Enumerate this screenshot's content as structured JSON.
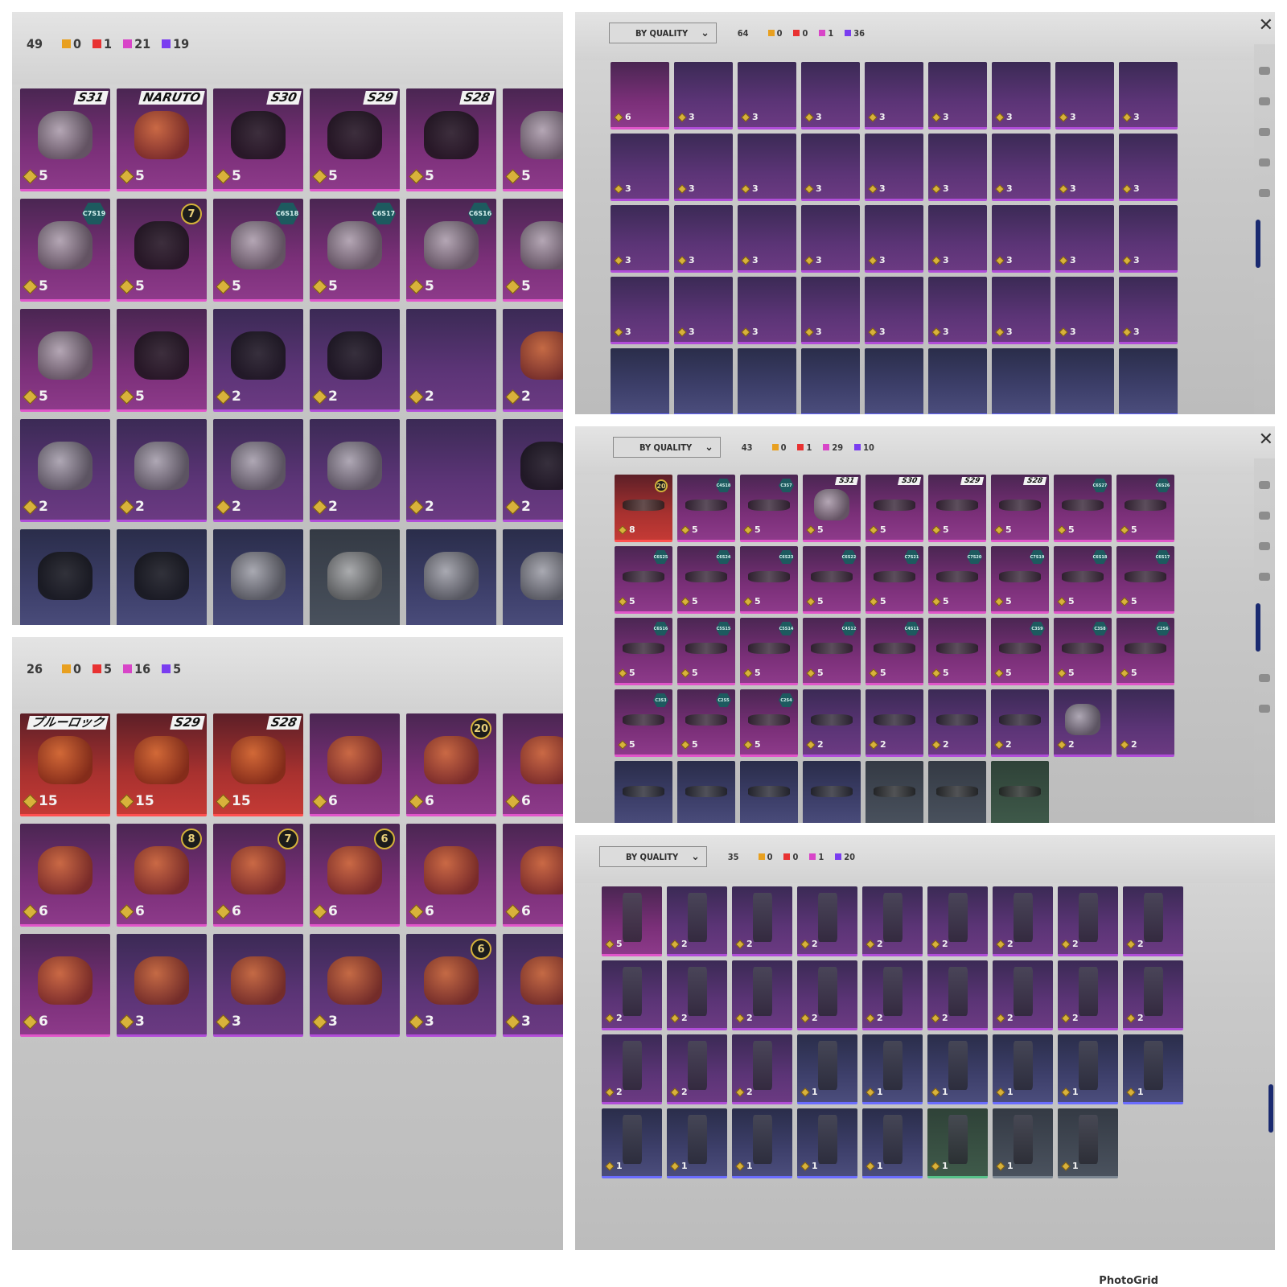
{
  "colors": {
    "orange": "#e8a020",
    "red": "#e83232",
    "pink": "#d845c8",
    "purple": "#7a3df0"
  },
  "panels": {
    "masks": {
      "header": {
        "total": "49",
        "counts": [
          "0",
          "1",
          "21",
          "19"
        ]
      },
      "cols": 6,
      "cards": [
        {
          "r": "pink",
          "t": "gear",
          "b": "S31",
          "v": "5"
        },
        {
          "r": "pink",
          "t": "helm",
          "b": "NARUTO",
          "v": "5"
        },
        {
          "r": "pink",
          "t": "mask",
          "b": "S30",
          "v": "5"
        },
        {
          "r": "pink",
          "t": "mask",
          "b": "S29",
          "v": "5"
        },
        {
          "r": "pink",
          "t": "mask",
          "b": "S28",
          "v": "5"
        },
        {
          "r": "pink",
          "t": "gear",
          "v": "5"
        },
        {
          "r": "pink",
          "t": "gear",
          "h": "C7S19",
          "v": "5"
        },
        {
          "r": "pink",
          "t": "mask",
          "g": "7",
          "v": "5"
        },
        {
          "r": "pink",
          "t": "gear",
          "h": "C6S18",
          "v": "5"
        },
        {
          "r": "pink",
          "t": "gear",
          "h": "C6S17",
          "v": "5"
        },
        {
          "r": "pink",
          "t": "gear",
          "h": "C6S16",
          "v": "5"
        },
        {
          "r": "pink",
          "t": "gear",
          "v": "5"
        },
        {
          "r": "pink",
          "t": "gear",
          "v": "5"
        },
        {
          "r": "pink",
          "t": "mask",
          "v": "5"
        },
        {
          "r": "purple",
          "t": "mask",
          "v": "2"
        },
        {
          "r": "purple",
          "t": "mask",
          "v": "2"
        },
        {
          "r": "purple",
          "t": "top",
          "v": "2"
        },
        {
          "r": "purple",
          "t": "helm",
          "v": "2"
        },
        {
          "r": "purple",
          "t": "gear",
          "v": "2"
        },
        {
          "r": "purple",
          "t": "gear",
          "v": "2"
        },
        {
          "r": "purple",
          "t": "gear",
          "v": "2"
        },
        {
          "r": "purple",
          "t": "gear",
          "v": "2"
        },
        {
          "r": "purple",
          "t": "top",
          "v": "2"
        },
        {
          "r": "purple",
          "t": "mask",
          "v": "2"
        },
        {
          "r": "blue",
          "t": "mask"
        },
        {
          "r": "blue",
          "t": "mask"
        },
        {
          "r": "blue",
          "t": "gear"
        },
        {
          "r": "gray",
          "t": "gear"
        },
        {
          "r": "blue",
          "t": "gear"
        },
        {
          "r": "blue",
          "t": "gear"
        }
      ]
    },
    "helmets": {
      "header": {
        "total": "26",
        "counts": [
          "0",
          "5",
          "16",
          "5"
        ]
      },
      "cols": 6,
      "cards": [
        {
          "r": "red",
          "t": "helm",
          "b": "ブルーロック",
          "v": "15"
        },
        {
          "r": "red",
          "t": "helm",
          "b": "S29",
          "v": "15"
        },
        {
          "r": "red",
          "t": "helm",
          "b": "S28",
          "v": "15"
        },
        {
          "r": "pink",
          "t": "helm",
          "v": "6"
        },
        {
          "r": "pink",
          "t": "helm",
          "g": "20",
          "v": "6"
        },
        {
          "r": "pink",
          "t": "helm",
          "v": "6"
        },
        {
          "r": "pink",
          "t": "helm",
          "v": "6"
        },
        {
          "r": "pink",
          "t": "helm",
          "g": "8",
          "v": "6"
        },
        {
          "r": "pink",
          "t": "helm",
          "g": "7",
          "v": "6"
        },
        {
          "r": "pink",
          "t": "helm",
          "g": "6",
          "v": "6"
        },
        {
          "r": "pink",
          "t": "helm",
          "v": "6"
        },
        {
          "r": "pink",
          "t": "helm",
          "v": "6"
        },
        {
          "r": "pink",
          "t": "helm",
          "v": "6"
        },
        {
          "r": "purple",
          "t": "helm",
          "v": "3"
        },
        {
          "r": "purple",
          "t": "helm",
          "v": "3"
        },
        {
          "r": "purple",
          "t": "helm",
          "v": "3"
        },
        {
          "r": "purple",
          "t": "helm",
          "g": "6",
          "v": "3"
        },
        {
          "r": "purple",
          "t": "helm",
          "v": "3"
        }
      ]
    },
    "tops": {
      "header": {
        "sort": "BY QUALITY",
        "total": "64",
        "counts": [
          "0",
          "0",
          "1",
          "36"
        ]
      },
      "cols": 9,
      "cards": [
        {
          "r": "pink",
          "t": "top",
          "v": "6"
        },
        {
          "r": "purple",
          "t": "top",
          "v": "3"
        },
        {
          "r": "purple",
          "t": "top",
          "v": "3"
        },
        {
          "r": "purple",
          "t": "top",
          "v": "3"
        },
        {
          "r": "purple",
          "t": "top",
          "v": "3"
        },
        {
          "r": "purple",
          "t": "top",
          "v": "3"
        },
        {
          "r": "purple",
          "t": "top",
          "v": "3"
        },
        {
          "r": "purple",
          "t": "top",
          "v": "3"
        },
        {
          "r": "purple",
          "t": "top",
          "v": "3"
        },
        {
          "r": "purple",
          "t": "top",
          "v": "3"
        },
        {
          "r": "purple",
          "t": "top",
          "v": "3"
        },
        {
          "r": "purple",
          "t": "top",
          "v": "3"
        },
        {
          "r": "purple",
          "t": "top",
          "v": "3"
        },
        {
          "r": "purple",
          "t": "top",
          "v": "3"
        },
        {
          "r": "purple",
          "t": "top",
          "v": "3"
        },
        {
          "r": "purple",
          "t": "top",
          "v": "3"
        },
        {
          "r": "purple",
          "t": "top",
          "v": "3"
        },
        {
          "r": "purple",
          "t": "top",
          "v": "3"
        },
        {
          "r": "purple",
          "t": "top",
          "v": "3"
        },
        {
          "r": "purple",
          "t": "top",
          "v": "3"
        },
        {
          "r": "purple",
          "t": "top",
          "v": "3"
        },
        {
          "r": "purple",
          "t": "top",
          "v": "3"
        },
        {
          "r": "purple",
          "t": "top",
          "v": "3"
        },
        {
          "r": "purple",
          "t": "top",
          "v": "3"
        },
        {
          "r": "purple",
          "t": "top",
          "v": "3"
        },
        {
          "r": "purple",
          "t": "top",
          "v": "3"
        },
        {
          "r": "purple",
          "t": "top",
          "v": "3"
        },
        {
          "r": "purple",
          "t": "top",
          "v": "3"
        },
        {
          "r": "purple",
          "t": "top",
          "v": "3"
        },
        {
          "r": "purple",
          "t": "top",
          "v": "3"
        },
        {
          "r": "purple",
          "t": "top",
          "v": "3"
        },
        {
          "r": "purple",
          "t": "top",
          "v": "3"
        },
        {
          "r": "purple",
          "t": "top",
          "v": "3"
        },
        {
          "r": "purple",
          "t": "top",
          "v": "3"
        },
        {
          "r": "purple",
          "t": "top",
          "v": "3"
        },
        {
          "r": "purple",
          "t": "top",
          "v": "3"
        },
        {
          "r": "blue",
          "t": "top"
        },
        {
          "r": "blue",
          "t": "top"
        },
        {
          "r": "blue",
          "t": "top"
        },
        {
          "r": "blue",
          "t": "top"
        },
        {
          "r": "blue",
          "t": "top"
        },
        {
          "r": "blue",
          "t": "top"
        },
        {
          "r": "blue",
          "t": "top"
        },
        {
          "r": "blue",
          "t": "top"
        },
        {
          "r": "blue",
          "t": "top"
        }
      ]
    },
    "glasses": {
      "header": {
        "sort": "BY QUALITY",
        "total": "43",
        "counts": [
          "0",
          "1",
          "29",
          "10"
        ]
      },
      "cols": 9,
      "cards": [
        {
          "r": "red",
          "t": "glass",
          "g": "20",
          "v": "8"
        },
        {
          "r": "pink",
          "t": "glass",
          "h": "C4S18",
          "v": "5"
        },
        {
          "r": "pink",
          "t": "glass",
          "h": "C3S7",
          "v": "5"
        },
        {
          "r": "pink",
          "t": "gear",
          "b": "S31",
          "v": "5"
        },
        {
          "r": "pink",
          "t": "glass",
          "b": "S30",
          "v": "5"
        },
        {
          "r": "pink",
          "t": "glass",
          "b": "S29",
          "v": "5"
        },
        {
          "r": "pink",
          "t": "glass",
          "b": "S28",
          "v": "5"
        },
        {
          "r": "pink",
          "t": "glass",
          "h": "C6S27",
          "v": "5"
        },
        {
          "r": "pink",
          "t": "glass",
          "h": "C6S26",
          "v": "5"
        },
        {
          "r": "pink",
          "t": "glass",
          "h": "C6S25",
          "v": "5"
        },
        {
          "r": "pink",
          "t": "glass",
          "h": "C6S24",
          "v": "5"
        },
        {
          "r": "pink",
          "t": "glass",
          "h": "C6S23",
          "v": "5"
        },
        {
          "r": "pink",
          "t": "glass",
          "h": "C6S22",
          "v": "5"
        },
        {
          "r": "pink",
          "t": "glass",
          "h": "C7S21",
          "v": "5"
        },
        {
          "r": "pink",
          "t": "glass",
          "h": "C7S20",
          "v": "5"
        },
        {
          "r": "pink",
          "t": "glass",
          "h": "C7S19",
          "v": "5"
        },
        {
          "r": "pink",
          "t": "glass",
          "h": "C6S18",
          "v": "5"
        },
        {
          "r": "pink",
          "t": "glass",
          "h": "C6S17",
          "v": "5"
        },
        {
          "r": "pink",
          "t": "glass",
          "h": "C6S16",
          "v": "5"
        },
        {
          "r": "pink",
          "t": "glass",
          "h": "C5S15",
          "v": "5"
        },
        {
          "r": "pink",
          "t": "glass",
          "h": "C5S14",
          "v": "5"
        },
        {
          "r": "pink",
          "t": "glass",
          "h": "C4S12",
          "v": "5"
        },
        {
          "r": "pink",
          "t": "glass",
          "h": "C4S11",
          "v": "5"
        },
        {
          "r": "pink",
          "t": "glass",
          "v": "5"
        },
        {
          "r": "pink",
          "t": "glass",
          "h": "C3S9",
          "v": "5"
        },
        {
          "r": "pink",
          "t": "glass",
          "h": "C3S8",
          "v": "5"
        },
        {
          "r": "pink",
          "t": "glass",
          "h": "C2S6",
          "v": "5"
        },
        {
          "r": "pink",
          "t": "glass",
          "h": "C3S3",
          "v": "5"
        },
        {
          "r": "pink",
          "t": "glass",
          "h": "C2S5",
          "v": "5"
        },
        {
          "r": "pink",
          "t": "glass",
          "h": "C2S4",
          "v": "5"
        },
        {
          "r": "purple",
          "t": "glass",
          "v": "2"
        },
        {
          "r": "purple",
          "t": "glass",
          "v": "2"
        },
        {
          "r": "purple",
          "t": "glass",
          "v": "2"
        },
        {
          "r": "purple",
          "t": "glass",
          "v": "2"
        },
        {
          "r": "purple",
          "t": "gear",
          "v": "2"
        },
        {
          "r": "purple",
          "t": "top",
          "v": "2"
        },
        {
          "r": "blue",
          "t": "glass"
        },
        {
          "r": "blue",
          "t": "glass"
        },
        {
          "r": "blue",
          "t": "glass"
        },
        {
          "r": "blue",
          "t": "glass"
        },
        {
          "r": "gray",
          "t": "glass"
        },
        {
          "r": "gray",
          "t": "glass"
        },
        {
          "r": "green",
          "t": "glass"
        }
      ]
    },
    "pants": {
      "header": {
        "sort": "BY QUALITY",
        "total": "35",
        "counts": [
          "0",
          "0",
          "1",
          "20"
        ]
      },
      "cols": 9,
      "cards": [
        {
          "r": "pink",
          "t": "pant",
          "v": "5"
        },
        {
          "r": "purple",
          "t": "pant",
          "v": "2"
        },
        {
          "r": "purple",
          "t": "pant",
          "v": "2"
        },
        {
          "r": "purple",
          "t": "pant",
          "v": "2"
        },
        {
          "r": "purple",
          "t": "pant",
          "v": "2"
        },
        {
          "r": "purple",
          "t": "pant",
          "v": "2"
        },
        {
          "r": "purple",
          "t": "pant",
          "v": "2"
        },
        {
          "r": "purple",
          "t": "pant",
          "v": "2"
        },
        {
          "r": "purple",
          "t": "pant",
          "v": "2"
        },
        {
          "r": "purple",
          "t": "pant",
          "v": "2"
        },
        {
          "r": "purple",
          "t": "pant",
          "v": "2"
        },
        {
          "r": "purple",
          "t": "pant",
          "v": "2"
        },
        {
          "r": "purple",
          "t": "pant",
          "v": "2"
        },
        {
          "r": "purple",
          "t": "pant",
          "v": "2"
        },
        {
          "r": "purple",
          "t": "pant",
          "v": "2"
        },
        {
          "r": "purple",
          "t": "pant",
          "v": "2"
        },
        {
          "r": "purple",
          "t": "pant",
          "v": "2"
        },
        {
          "r": "purple",
          "t": "pant",
          "v": "2"
        },
        {
          "r": "purple",
          "t": "pant",
          "v": "2"
        },
        {
          "r": "purple",
          "t": "pant",
          "v": "2"
        },
        {
          "r": "purple",
          "t": "pant",
          "v": "2"
        },
        {
          "r": "blue",
          "t": "pant",
          "v": "1"
        },
        {
          "r": "blue",
          "t": "pant",
          "v": "1"
        },
        {
          "r": "blue",
          "t": "pant",
          "v": "1"
        },
        {
          "r": "blue",
          "t": "pant",
          "v": "1"
        },
        {
          "r": "blue",
          "t": "pant",
          "v": "1"
        },
        {
          "r": "blue",
          "t": "pant",
          "v": "1"
        },
        {
          "r": "blue",
          "t": "pant",
          "v": "1"
        },
        {
          "r": "blue",
          "t": "pant",
          "v": "1"
        },
        {
          "r": "blue",
          "t": "pant",
          "v": "1"
        },
        {
          "r": "blue",
          "t": "pant",
          "v": "1"
        },
        {
          "r": "blue",
          "t": "pant",
          "v": "1"
        },
        {
          "r": "green",
          "t": "pant",
          "v": "1"
        },
        {
          "r": "gray",
          "t": "pant",
          "v": "1"
        },
        {
          "r": "gray",
          "t": "pant",
          "v": "1"
        }
      ]
    }
  },
  "watermark": "PhotoGrid"
}
